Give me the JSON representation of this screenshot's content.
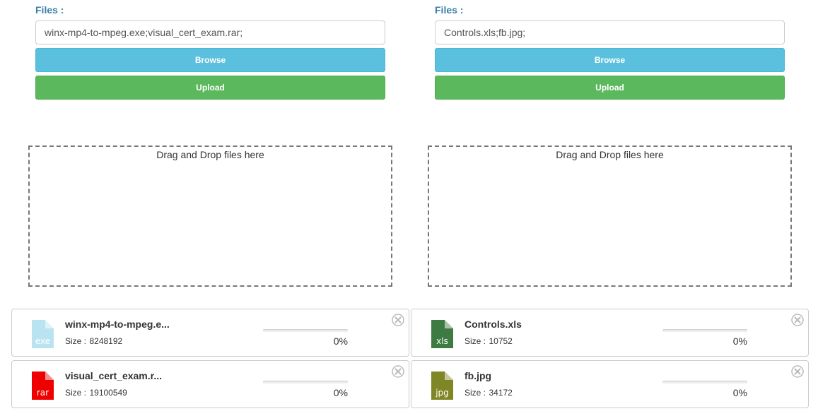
{
  "panels": [
    {
      "files_label": "Files :",
      "files_value": "winx-mp4-to-mpeg.exe;visual_cert_exam.rar;",
      "browse_label": "Browse",
      "upload_label": "Upload",
      "drop_text": "Drag and Drop files here"
    },
    {
      "files_label": "Files :",
      "files_value": "Controls.xls;fb.jpg;",
      "browse_label": "Browse",
      "upload_label": "Upload",
      "drop_text": "Drag and Drop files here"
    }
  ],
  "files": [
    {
      "name": "winx-mp4-to-mpeg.e...",
      "size_label": "Size :",
      "size": "8248192",
      "progress": 0,
      "progress_text": "0%",
      "icon": "exe-file-icon",
      "ext": "exe",
      "color": "#b9e3f1"
    },
    {
      "name": "visual_cert_exam.r...",
      "size_label": "Size :",
      "size": "19100549",
      "progress": 0,
      "progress_text": "0%",
      "icon": "rar-file-icon",
      "ext": "rar",
      "color": "#ee0000"
    },
    {
      "name": "Controls.xls",
      "size_label": "Size :",
      "size": "10752",
      "progress": 0,
      "progress_text": "0%",
      "icon": "xls-file-icon",
      "ext": "xls",
      "color": "#3e7b43"
    },
    {
      "name": "fb.jpg",
      "size_label": "Size :",
      "size": "34172",
      "progress": 0,
      "progress_text": "0%",
      "icon": "jpg-file-icon",
      "ext": "jpg",
      "color": "#7f8625"
    }
  ],
  "colors": {
    "label": "#3a7fa8",
    "browse": "#5bc0de",
    "upload": "#5cb85c"
  }
}
